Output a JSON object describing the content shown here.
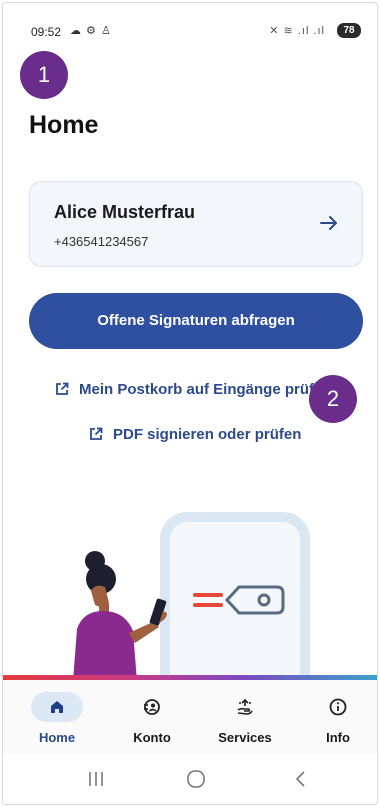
{
  "status_bar": {
    "time": "09:52",
    "left_icons": "☁ ⚙ ♙",
    "right_icons": "✕ ≋ .ıl .ıl",
    "battery": "78"
  },
  "annotations": {
    "badge1": "1",
    "badge2": "2"
  },
  "page": {
    "title": "Home"
  },
  "account": {
    "name": "Alice Musterfrau",
    "phone": "+436541234567"
  },
  "actions": {
    "primary": "Offene Signaturen abfragen",
    "link1": "Mein Postkorb auf Eingänge prüfen",
    "link2": "PDF signieren oder prüfen"
  },
  "nav": {
    "items": [
      {
        "label": "Home",
        "icon": "home-icon",
        "active": true
      },
      {
        "label": "Konto",
        "icon": "account-icon",
        "active": false
      },
      {
        "label": "Services",
        "icon": "services-icon",
        "active": false
      },
      {
        "label": "Info",
        "icon": "info-icon",
        "active": false
      }
    ]
  },
  "colors": {
    "primary": "#2f4fa0",
    "link": "#2c4a8c",
    "badge": "#6b2d8b",
    "card_bg": "#f3f6fa",
    "nav_active_bg": "#dde8f7"
  }
}
